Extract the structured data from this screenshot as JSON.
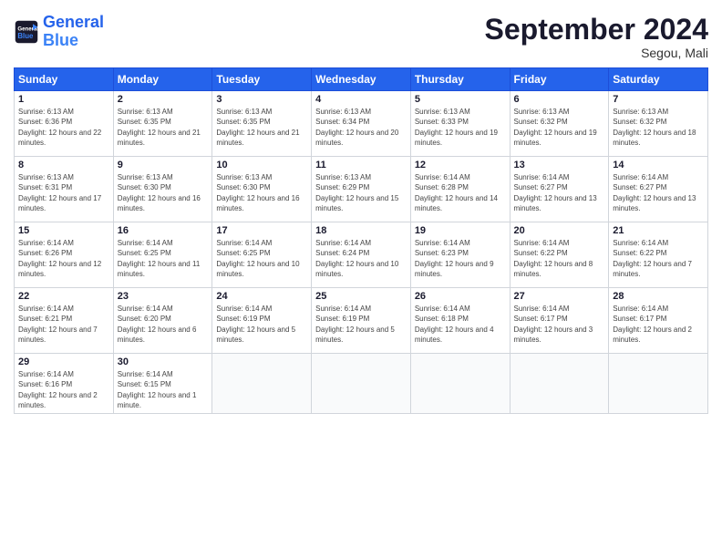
{
  "header": {
    "logo_general": "General",
    "logo_blue": "Blue",
    "month_title": "September 2024",
    "subtitle": "Segou, Mali"
  },
  "days_of_week": [
    "Sunday",
    "Monday",
    "Tuesday",
    "Wednesday",
    "Thursday",
    "Friday",
    "Saturday"
  ],
  "weeks": [
    [
      {
        "day": "1",
        "sunrise": "6:13 AM",
        "sunset": "6:36 PM",
        "daylight": "12 hours and 22 minutes."
      },
      {
        "day": "2",
        "sunrise": "6:13 AM",
        "sunset": "6:35 PM",
        "daylight": "12 hours and 21 minutes."
      },
      {
        "day": "3",
        "sunrise": "6:13 AM",
        "sunset": "6:35 PM",
        "daylight": "12 hours and 21 minutes."
      },
      {
        "day": "4",
        "sunrise": "6:13 AM",
        "sunset": "6:34 PM",
        "daylight": "12 hours and 20 minutes."
      },
      {
        "day": "5",
        "sunrise": "6:13 AM",
        "sunset": "6:33 PM",
        "daylight": "12 hours and 19 minutes."
      },
      {
        "day": "6",
        "sunrise": "6:13 AM",
        "sunset": "6:32 PM",
        "daylight": "12 hours and 19 minutes."
      },
      {
        "day": "7",
        "sunrise": "6:13 AM",
        "sunset": "6:32 PM",
        "daylight": "12 hours and 18 minutes."
      }
    ],
    [
      {
        "day": "8",
        "sunrise": "6:13 AM",
        "sunset": "6:31 PM",
        "daylight": "12 hours and 17 minutes."
      },
      {
        "day": "9",
        "sunrise": "6:13 AM",
        "sunset": "6:30 PM",
        "daylight": "12 hours and 16 minutes."
      },
      {
        "day": "10",
        "sunrise": "6:13 AM",
        "sunset": "6:30 PM",
        "daylight": "12 hours and 16 minutes."
      },
      {
        "day": "11",
        "sunrise": "6:13 AM",
        "sunset": "6:29 PM",
        "daylight": "12 hours and 15 minutes."
      },
      {
        "day": "12",
        "sunrise": "6:14 AM",
        "sunset": "6:28 PM",
        "daylight": "12 hours and 14 minutes."
      },
      {
        "day": "13",
        "sunrise": "6:14 AM",
        "sunset": "6:27 PM",
        "daylight": "12 hours and 13 minutes."
      },
      {
        "day": "14",
        "sunrise": "6:14 AM",
        "sunset": "6:27 PM",
        "daylight": "12 hours and 13 minutes."
      }
    ],
    [
      {
        "day": "15",
        "sunrise": "6:14 AM",
        "sunset": "6:26 PM",
        "daylight": "12 hours and 12 minutes."
      },
      {
        "day": "16",
        "sunrise": "6:14 AM",
        "sunset": "6:25 PM",
        "daylight": "12 hours and 11 minutes."
      },
      {
        "day": "17",
        "sunrise": "6:14 AM",
        "sunset": "6:25 PM",
        "daylight": "12 hours and 10 minutes."
      },
      {
        "day": "18",
        "sunrise": "6:14 AM",
        "sunset": "6:24 PM",
        "daylight": "12 hours and 10 minutes."
      },
      {
        "day": "19",
        "sunrise": "6:14 AM",
        "sunset": "6:23 PM",
        "daylight": "12 hours and 9 minutes."
      },
      {
        "day": "20",
        "sunrise": "6:14 AM",
        "sunset": "6:22 PM",
        "daylight": "12 hours and 8 minutes."
      },
      {
        "day": "21",
        "sunrise": "6:14 AM",
        "sunset": "6:22 PM",
        "daylight": "12 hours and 7 minutes."
      }
    ],
    [
      {
        "day": "22",
        "sunrise": "6:14 AM",
        "sunset": "6:21 PM",
        "daylight": "12 hours and 7 minutes."
      },
      {
        "day": "23",
        "sunrise": "6:14 AM",
        "sunset": "6:20 PM",
        "daylight": "12 hours and 6 minutes."
      },
      {
        "day": "24",
        "sunrise": "6:14 AM",
        "sunset": "6:19 PM",
        "daylight": "12 hours and 5 minutes."
      },
      {
        "day": "25",
        "sunrise": "6:14 AM",
        "sunset": "6:19 PM",
        "daylight": "12 hours and 5 minutes."
      },
      {
        "day": "26",
        "sunrise": "6:14 AM",
        "sunset": "6:18 PM",
        "daylight": "12 hours and 4 minutes."
      },
      {
        "day": "27",
        "sunrise": "6:14 AM",
        "sunset": "6:17 PM",
        "daylight": "12 hours and 3 minutes."
      },
      {
        "day": "28",
        "sunrise": "6:14 AM",
        "sunset": "6:17 PM",
        "daylight": "12 hours and 2 minutes."
      }
    ],
    [
      {
        "day": "29",
        "sunrise": "6:14 AM",
        "sunset": "6:16 PM",
        "daylight": "12 hours and 2 minutes."
      },
      {
        "day": "30",
        "sunrise": "6:14 AM",
        "sunset": "6:15 PM",
        "daylight": "12 hours and 1 minute."
      },
      null,
      null,
      null,
      null,
      null
    ]
  ]
}
